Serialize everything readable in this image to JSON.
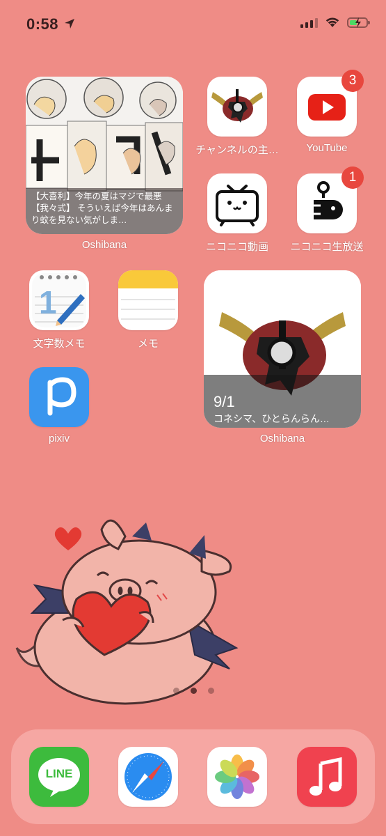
{
  "status_bar": {
    "time": "0:58"
  },
  "widgets": [
    {
      "app": "Oshibana",
      "caption": "【大喜利】今年の夏はマジで最悪【我々式】 そういえば今年はあんまり蚊を見ない気がしま…"
    },
    {
      "app": "Oshibana",
      "date": "9/1",
      "caption": "コネシマ、ひとらんらん…"
    }
  ],
  "apps": {
    "channel": {
      "label": "チャンネルの主…"
    },
    "youtube": {
      "label": "YouTube",
      "badge": "3"
    },
    "niconico": {
      "label": "ニコニコ動画"
    },
    "nicolive": {
      "label": "ニコニコ生放送",
      "badge": "1"
    },
    "mojisu": {
      "label": "文字数メモ"
    },
    "memo": {
      "label": "メモ"
    },
    "pixiv": {
      "label": "pixiv"
    }
  },
  "dock": {
    "line": {
      "icon_text": "LINE"
    }
  },
  "page_indicator": {
    "pages": 3,
    "current": 2
  },
  "colors": {
    "wallpaper": "#ef8c86",
    "badge": "#e8473e"
  }
}
